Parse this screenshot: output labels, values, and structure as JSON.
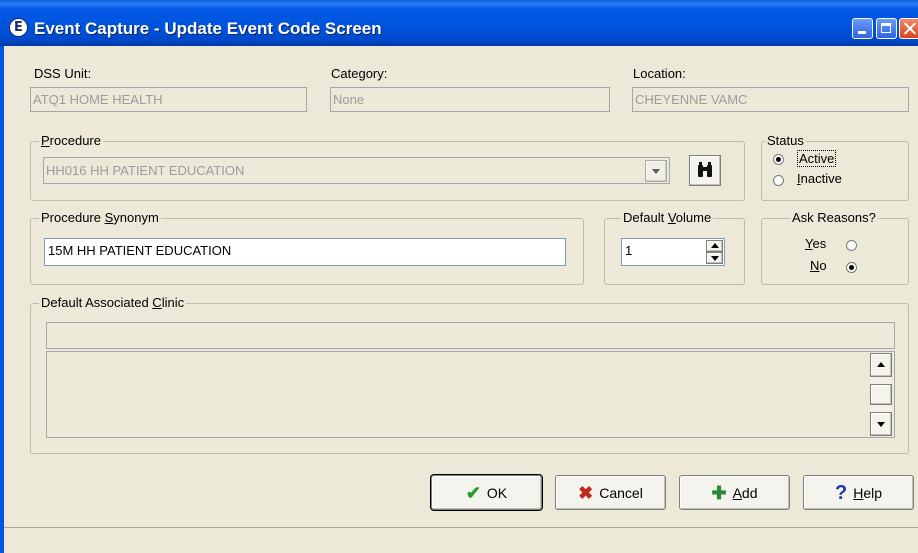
{
  "window": {
    "title": "Event Capture - Update Event Code Screen",
    "app_icon": "E"
  },
  "header_fields": {
    "dss_unit": {
      "label": "DSS Unit:",
      "value": "ATQ1 HOME HEALTH"
    },
    "category": {
      "label": "Category:",
      "value": "None"
    },
    "location": {
      "label": "Location:",
      "value": "CHEYENNE VAMC"
    }
  },
  "procedure": {
    "label": "Procedure",
    "value": "HH016 HH PATIENT EDUCATION",
    "search_icon": "binoculars-icon"
  },
  "status": {
    "label": "Status",
    "options": [
      {
        "label": "Active",
        "selected": true
      },
      {
        "label": "Inactive",
        "selected": false
      }
    ]
  },
  "procedure_synonym": {
    "label_prefix": "Procedure ",
    "label_underlined": "S",
    "label_suffix": "ynonym",
    "value": "15M HH PATIENT EDUCATION"
  },
  "default_volume": {
    "label_prefix": "Default ",
    "label_underlined": "V",
    "label_suffix": "olume",
    "value": "1"
  },
  "ask_reasons": {
    "label": "Ask Reasons?",
    "yes": {
      "underlined": "Y",
      "rest": "es",
      "selected": false
    },
    "no": {
      "underlined": "N",
      "rest": "o",
      "selected": true
    }
  },
  "default_clinic": {
    "label_prefix": "Default Associated ",
    "label_underlined": "C",
    "label_suffix": "linic",
    "value": ""
  },
  "buttons": {
    "ok": {
      "label": "OK",
      "icon": "checkmark-icon"
    },
    "cancel": {
      "label": "Cancel",
      "icon": "x-icon"
    },
    "add": {
      "underlined": "A",
      "rest": "dd",
      "icon": "plus-icon"
    },
    "help": {
      "underlined": "H",
      "rest": "elp",
      "icon": "question-icon"
    }
  },
  "colors": {
    "titlebar": "#0054dc",
    "face": "#ece9d8",
    "ok_check": "#2a9a2a",
    "cancel_x": "#c0281c",
    "add_plus": "#2a8a3a",
    "help_q": "#1a3aa8"
  }
}
